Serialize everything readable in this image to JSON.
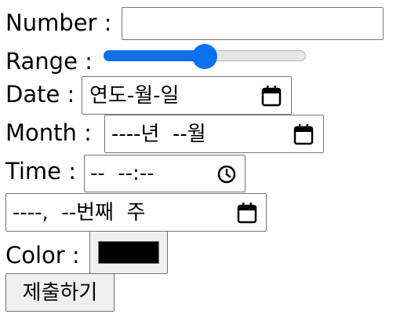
{
  "form": {
    "number_label": "Number : ",
    "number_value": "",
    "range_label": "Range : ",
    "range_value_fraction": 0.5,
    "date_label": "Date : ",
    "date_placeholder": "연도-월-일",
    "month_label": "Month : ",
    "month_placeholder": "----년  --월",
    "time_label": "Time : ",
    "time_placeholder": "--  --:--",
    "week_placeholder": "----,  --번째  주",
    "color_label": "Color : ",
    "color_value": "#000000",
    "submit_label": "제출하기"
  },
  "colors": {
    "accent": "#0a70f0",
    "track_empty": "#e6e6e6",
    "border": "#767676",
    "button_bg": "#efefef"
  },
  "icons": {
    "date": "calendar-icon",
    "month": "calendar-icon",
    "time": "clock-icon",
    "week": "calendar-icon"
  }
}
